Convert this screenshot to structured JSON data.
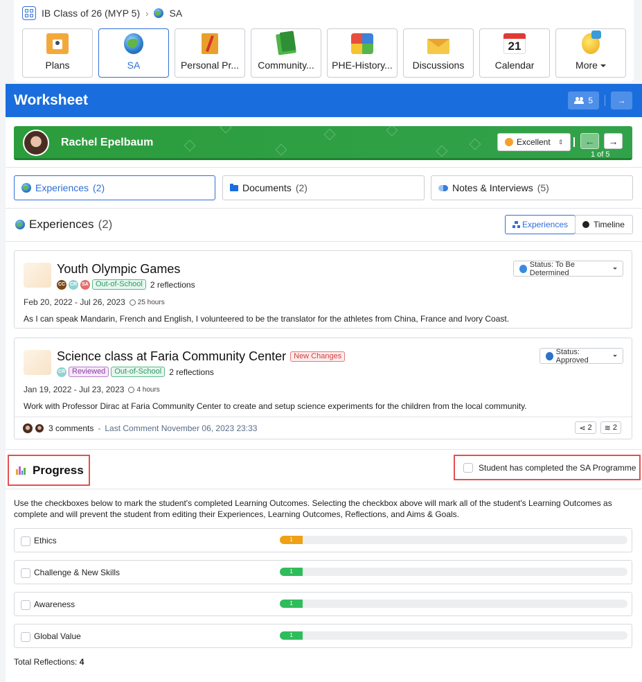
{
  "breadcrumb": {
    "class_name": "IB Class of 26 (MYP 5)",
    "current": "SA"
  },
  "nav_tiles": [
    {
      "label": "Plans",
      "icon": "plans-icon"
    },
    {
      "label": "SA",
      "icon": "globe-icon",
      "active": true
    },
    {
      "label": "Personal Pr...",
      "icon": "notebook-icon"
    },
    {
      "label": "Community...",
      "icon": "books-icon"
    },
    {
      "label": "PHE-History...",
      "icon": "puzzle-icon"
    },
    {
      "label": "Discussions",
      "icon": "envelope-icon"
    },
    {
      "label": "Calendar",
      "icon": "calendar-icon",
      "day": "21"
    },
    {
      "label": "More",
      "icon": "lightbulb-icon"
    }
  ],
  "worksheet": {
    "title": "Worksheet",
    "student_count": "5"
  },
  "student": {
    "name": "Rachel Epelbaum",
    "rating": "Excellent",
    "pager": "1 of 5"
  },
  "tabs": [
    {
      "label": "Experiences",
      "count": "(2)"
    },
    {
      "label": "Documents",
      "count": "(2)"
    },
    {
      "label": "Notes & Interviews",
      "count": "(5)"
    }
  ],
  "experiences_section": {
    "title": "Experiences",
    "count": "(2)",
    "view_structure": "Experiences",
    "view_timeline": "Timeline"
  },
  "experiences": [
    {
      "title": "Youth Olympic Games",
      "avatars": [
        "CC",
        "CR",
        "SA"
      ],
      "badges": [
        "Out-of-School"
      ],
      "reflections": "2 reflections",
      "dates": "Feb 20, 2022 - Jul 26, 2023",
      "hours": "25 hours",
      "description": "As I can speak Mandarin, French and English, I volunteered to be the translator for the athletes from China, France and Ivory Coast.",
      "status": "Status: To Be Determined"
    },
    {
      "title": "Science class at Faria Community Center",
      "new_badge": "New Changes",
      "avatars": [
        "CR"
      ],
      "badges": [
        "Reviewed",
        "Out-of-School"
      ],
      "reflections": "2 reflections",
      "dates": "Jan 19, 2022 - Jul 23, 2023",
      "hours": "4 hours",
      "description": "Work with Professor Dirac at Faria Community Center to create and setup science experiments for the children from the local community.",
      "status": "Status: Approved",
      "comments": "3 comments",
      "last_comment": "Last Comment November 06, 2023 23:33",
      "share_count": "2",
      "layers_count": "2"
    }
  ],
  "progress": {
    "title": "Progress",
    "complete_label": "Student has completed the SA Programme",
    "intro": "Use the checkboxes below to mark the student's completed Learning Outcomes. Selecting the checkbox above will mark all of the student's Learning Outcomes as complete and will prevent the student from editing their Experiences, Learning Outcomes, Reflections, and Aims & Goals.",
    "outcomes": [
      {
        "label": "Ethics",
        "value": "1",
        "fill_fraction": 0.066,
        "color": "#f0a013"
      },
      {
        "label": "Challenge & New Skills",
        "value": "1",
        "fill_fraction": 0.066,
        "color": "#2fbd5b"
      },
      {
        "label": "Awareness",
        "value": "1",
        "fill_fraction": 0.066,
        "color": "#2fbd5b"
      },
      {
        "label": "Global Value",
        "value": "1",
        "fill_fraction": 0.066,
        "color": "#2fbd5b"
      }
    ],
    "total_label": "Total Reflections:",
    "total_value": "4"
  }
}
